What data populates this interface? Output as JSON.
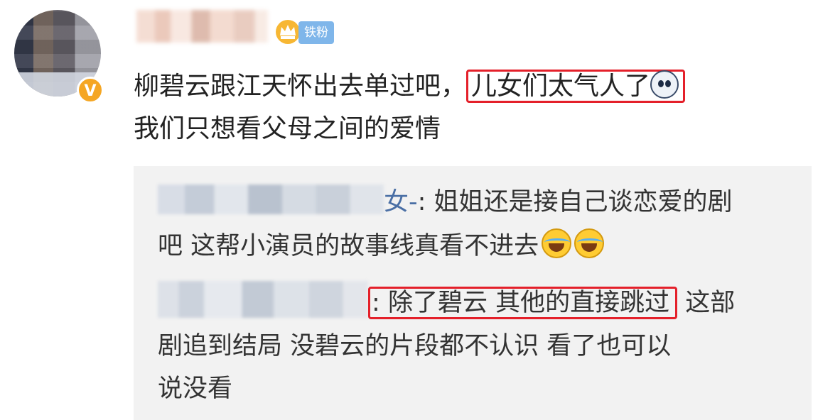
{
  "post": {
    "badge_label": "铁粉",
    "verified_mark": "V",
    "line1_prefix": "柳碧云跟江天怀出去单过吧，",
    "line1_highlight": "儿女们太气人了",
    "line2": "我们只想看父母之间的爱情"
  },
  "replies": [
    {
      "name_suffix": "女-",
      "text_line1": ": 姐姐还是接自己谈恋爱的剧",
      "text_line2": "吧 这帮小演员的故事线真看不进去"
    },
    {
      "text_prefix": ":",
      "text_highlight": "除了碧云 其他的直接跳过",
      "text_line1_suffix": " 这部",
      "text_line2": "剧追到结局 没碧云的片段都不认识  看了也可以",
      "text_line3": "说没看"
    }
  ],
  "icons": {
    "crown": "crown-icon",
    "emoji_scared": "scared-face-icon",
    "emoji_laugh_cry": "laugh-cry-icon"
  },
  "colors": {
    "highlight_border": "#e4202a",
    "fan_badge": "#7fb6ea",
    "vip_badge": "#f5a623",
    "reply_bg": "#f2f2f2"
  }
}
